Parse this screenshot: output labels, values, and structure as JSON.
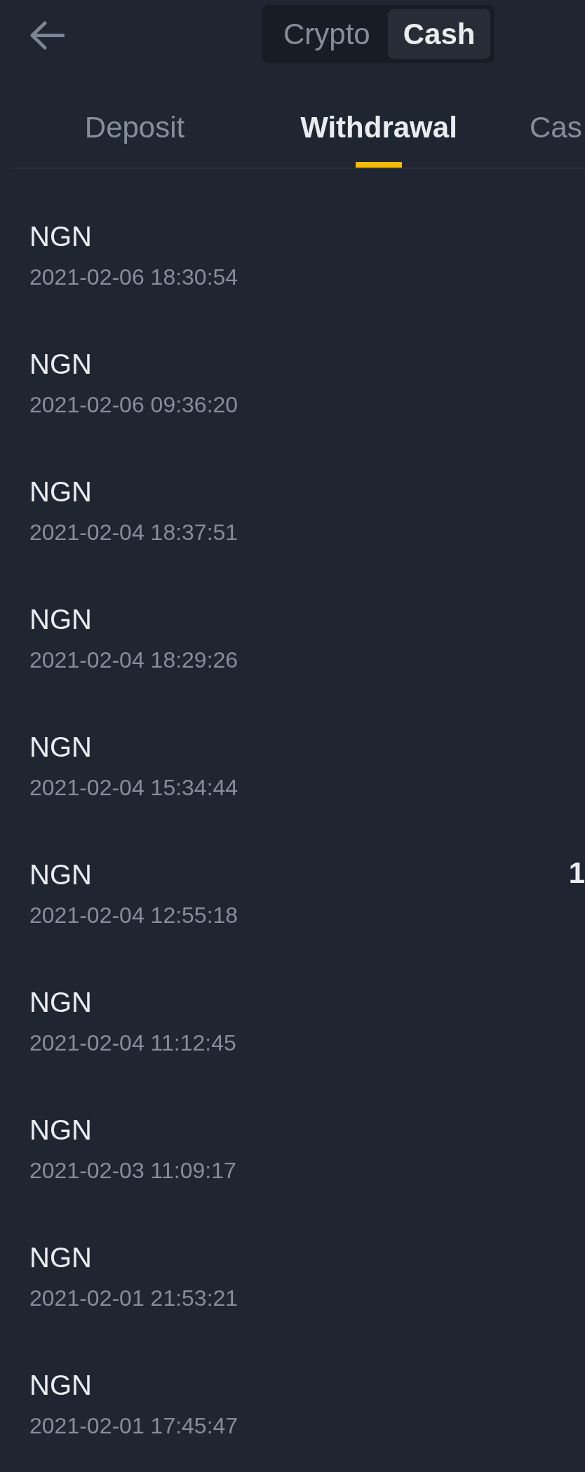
{
  "segments": [
    {
      "label": "Crypto",
      "selected": false
    },
    {
      "label": "Cash",
      "selected": true
    }
  ],
  "tabs": [
    {
      "label": "Deposit",
      "selected": false
    },
    {
      "label": "Withdrawal",
      "selected": true
    },
    {
      "label": "Cas",
      "selected": false
    }
  ],
  "transactions": [
    {
      "currency": "NGN",
      "time": "2021-02-06 18:30:54"
    },
    {
      "currency": "NGN",
      "time": "2021-02-06 09:36:20"
    },
    {
      "currency": "NGN",
      "time": "2021-02-04 18:37:51"
    },
    {
      "currency": "NGN",
      "time": "2021-02-04 18:29:26"
    },
    {
      "currency": "NGN",
      "time": "2021-02-04 15:34:44"
    },
    {
      "currency": "NGN",
      "time": "2021-02-04 12:55:18",
      "amount": "1"
    },
    {
      "currency": "NGN",
      "time": "2021-02-04 11:12:45"
    },
    {
      "currency": "NGN",
      "time": "2021-02-03 11:09:17"
    },
    {
      "currency": "NGN",
      "time": "2021-02-01 21:53:21"
    },
    {
      "currency": "NGN",
      "time": "2021-02-01 17:45:47"
    }
  ]
}
